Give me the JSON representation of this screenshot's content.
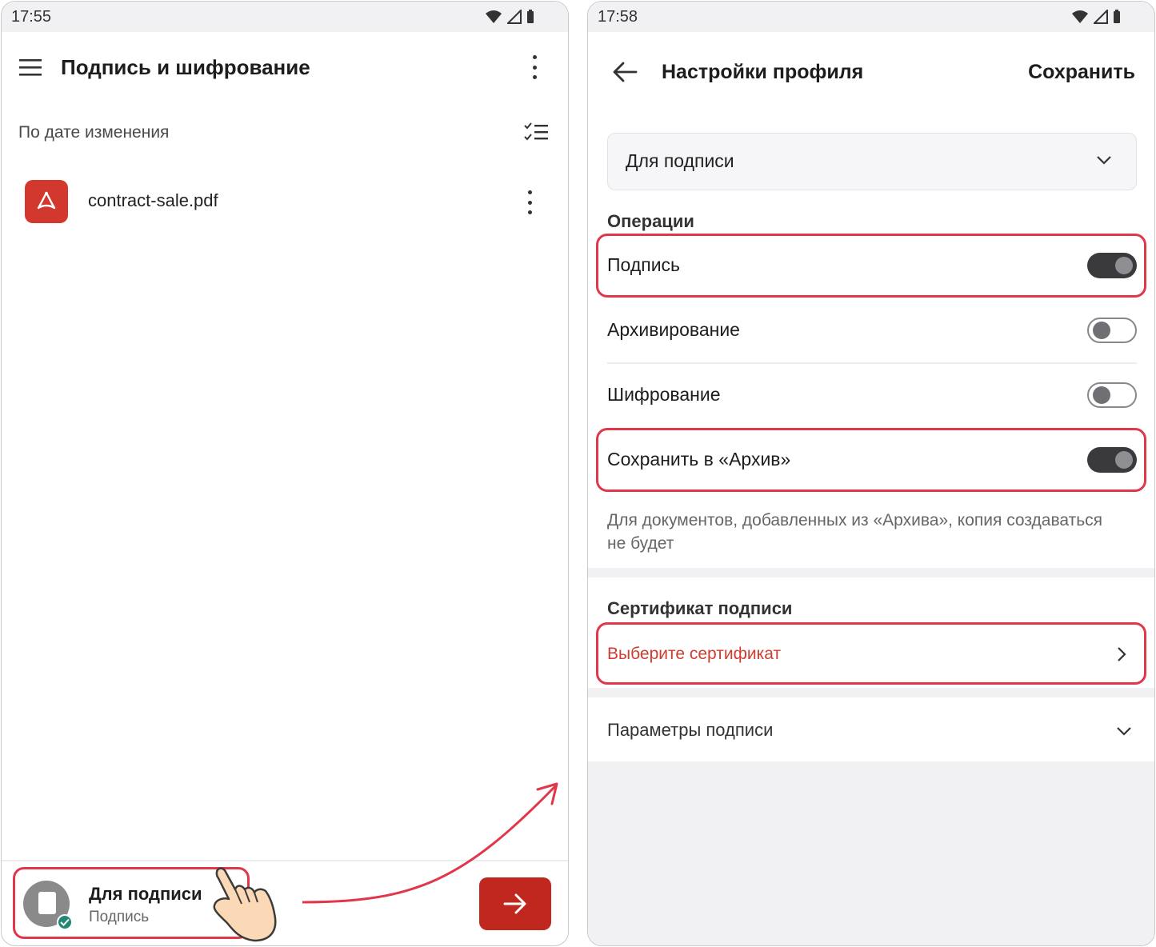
{
  "left_screen": {
    "status_time": "17:55",
    "title": "Подпись и шифрование",
    "sort_label": "По дате изменения",
    "files": [
      {
        "name": "contract-sale.pdf",
        "icon": "pdf-icon"
      }
    ],
    "profile_chip": {
      "title": "Для подписи",
      "subtitle": "Подпись"
    }
  },
  "right_screen": {
    "status_time": "17:58",
    "title": "Настройки профиля",
    "save_label": "Сохранить",
    "profile_select_value": "Для подписи",
    "operations_header": "Операции",
    "operations": [
      {
        "label": "Подпись",
        "enabled": true
      },
      {
        "label": "Архивирование",
        "enabled": false
      },
      {
        "label": "Шифрование",
        "enabled": false
      },
      {
        "label": "Сохранить в «Архив»",
        "enabled": true
      }
    ],
    "archive_note": "Для документов, добавленных из «Архива», копия создаваться не будет",
    "certificate_header": "Сертификат подписи",
    "certificate_action": "Выберите сертификат",
    "params_label": "Параметры подписи"
  },
  "colors": {
    "highlight": "#e0374a",
    "accent_button": "#c0281f",
    "pdf_icon": "#d3382e",
    "link_red": "#d23b2f",
    "toggle_on": "#3a3a3c"
  }
}
